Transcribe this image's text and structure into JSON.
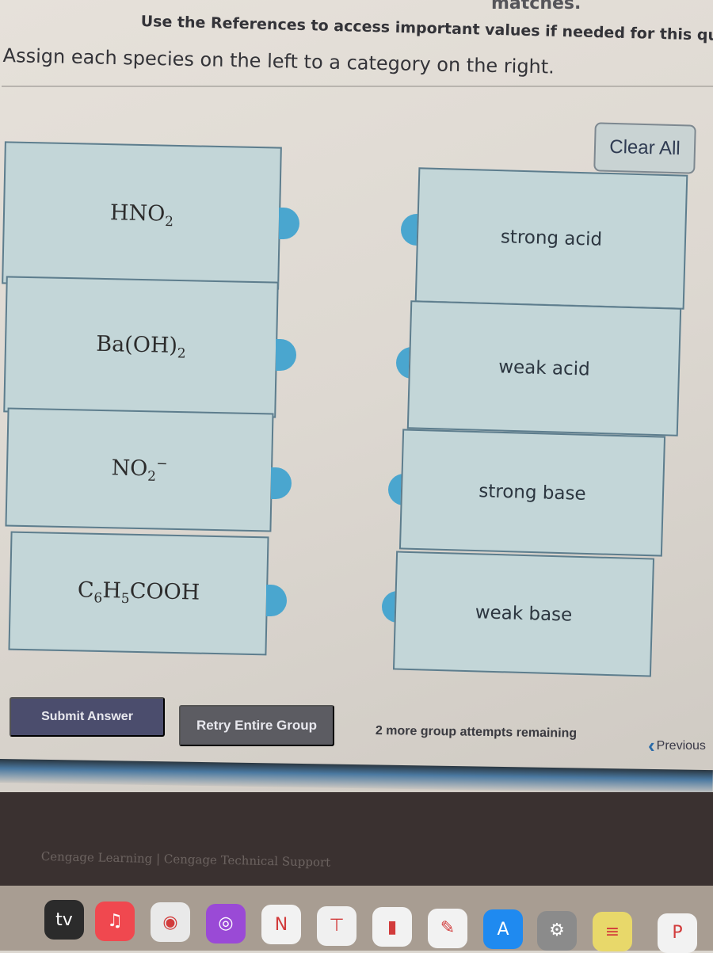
{
  "header": {
    "partial_top_text": "matches.",
    "references_note": "Use the References to access important values if needed for this que",
    "instructions": "Assign each species on the left to a category on the right."
  },
  "clear_all_label": "Clear All",
  "species": [
    {
      "base": "HNO",
      "sub": "2",
      "sup": "",
      "tail": ""
    },
    {
      "base": "Ba(OH)",
      "sub": "2",
      "sup": "",
      "tail": ""
    },
    {
      "base": "NO",
      "sub": "2",
      "sup": "−",
      "tail": ""
    },
    {
      "base": "C",
      "sub": "6",
      "mid": "H",
      "sub2": "5",
      "tail": "COOH"
    }
  ],
  "categories": [
    "strong acid",
    "weak acid",
    "strong base",
    "weak base"
  ],
  "actions": {
    "submit_label": "Submit Answer",
    "retry_label": "Retry Entire Group",
    "attempts_text": "2 more group attempts remaining",
    "previous_label": "Previous"
  },
  "footer": {
    "link1": "Cengage Learning",
    "separator": "|",
    "link2": "Cengage Technical Support"
  },
  "dock": [
    {
      "name": "apple-tv-icon",
      "glyph": "tv",
      "color": "#2b2b2b"
    },
    {
      "name": "music-icon",
      "glyph": "♫",
      "color": "#f0484f"
    },
    {
      "name": "chrome-icon",
      "glyph": "◉",
      "color": "#e9e9e9"
    },
    {
      "name": "podcasts-icon",
      "glyph": "◎",
      "color": "#9a4ad6"
    },
    {
      "name": "news-icon",
      "glyph": "N",
      "color": "#f2f2f2"
    },
    {
      "name": "keynote-icon",
      "glyph": "⊤",
      "color": "#f0f0f0"
    },
    {
      "name": "numbers-icon",
      "glyph": "▮",
      "color": "#f2f2f2"
    },
    {
      "name": "pages-icon",
      "glyph": "✎",
      "color": "#f2f2f2"
    },
    {
      "name": "app-store-icon",
      "glyph": "A",
      "color": "#1f8af0"
    },
    {
      "name": "system-settings-icon",
      "glyph": "⚙",
      "color": "#8b8b8b"
    },
    {
      "name": "notes-icon",
      "glyph": "≡",
      "color": "#e8d86a"
    },
    {
      "name": "powerpoint-icon",
      "glyph": "P",
      "color": "#f2f2f2"
    }
  ]
}
